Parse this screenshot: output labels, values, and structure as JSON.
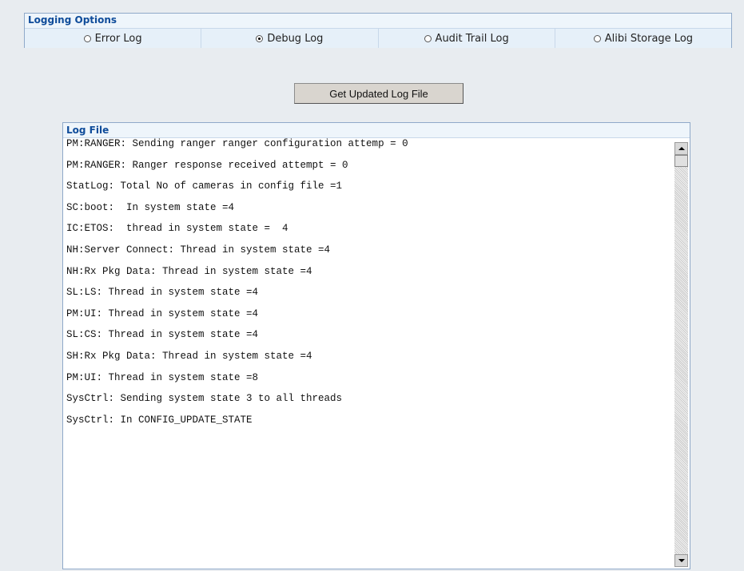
{
  "logging_options": {
    "title": "Logging Options",
    "options": [
      {
        "label": "Error Log",
        "selected": false
      },
      {
        "label": "Debug Log",
        "selected": true
      },
      {
        "label": "Audit Trail Log",
        "selected": false
      },
      {
        "label": "Alibi Storage Log",
        "selected": false
      }
    ]
  },
  "button": {
    "label": "Get Updated Log File"
  },
  "log_file": {
    "title": "Log File",
    "lines": [
      "PM:RANGER: Sending ranger ranger configuration attemp = 0",
      "PM:RANGER: Ranger response received attempt = 0",
      "StatLog: Total No of cameras in config file =1",
      "SC:boot:  In system state =4",
      "IC:ETOS:  thread in system state =  4",
      "NH:Server Connect: Thread in system state =4",
      "NH:Rx Pkg Data: Thread in system state =4",
      "SL:LS: Thread in system state =4",
      "PM:UI: Thread in system state =4",
      "SL:CS: Thread in system state =4",
      "SH:Rx Pkg Data: Thread in system state =4",
      "PM:UI: Thread in system state =8",
      "SysCtrl: Sending system state 3 to all threads",
      "SysCtrl: In CONFIG_UPDATE_STATE"
    ]
  }
}
